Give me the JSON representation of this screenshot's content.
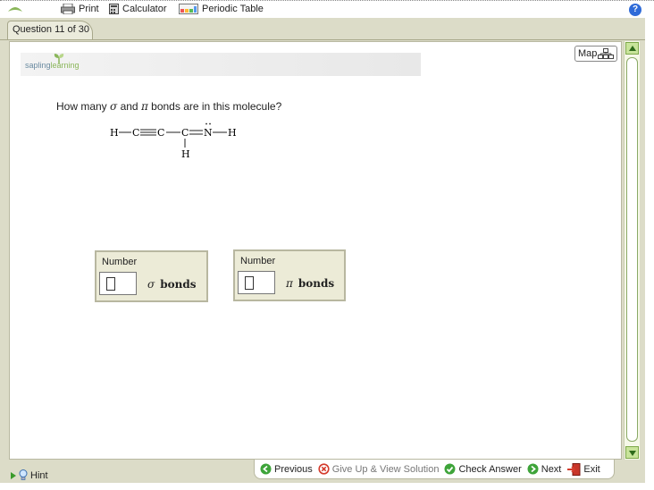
{
  "toolbar": {
    "print": "Print",
    "calculator": "Calculator",
    "periodic_table": "Periodic Table",
    "help": "?"
  },
  "tab": {
    "label": "Question 11 of 30"
  },
  "brand": {
    "part1": "sapling",
    "part2": "learning"
  },
  "map_button": {
    "label": "Map"
  },
  "question": {
    "text_pre": "How many ",
    "sigma": "σ",
    "text_mid": " and ",
    "pi": "π",
    "text_post": " bonds are in this molecule?"
  },
  "molecule": {
    "atoms": [
      "H",
      "C",
      "C",
      "C",
      "N",
      "H",
      "H"
    ]
  },
  "inputs": [
    {
      "label": "Number",
      "value": "",
      "symbol": "σ",
      "unit": "bonds"
    },
    {
      "label": "Number",
      "value": "",
      "symbol": "π",
      "unit": "bonds"
    }
  ],
  "hint": {
    "label": "Hint"
  },
  "nav": {
    "previous": "Previous",
    "give_up": "Give Up & View Solution",
    "check": "Check Answer",
    "next": "Next",
    "exit": "Exit"
  },
  "colors": {
    "frame": "#dcdcc8",
    "accent_green": "#3ea43a",
    "help_blue": "#2f6bd8",
    "exit_red": "#d43b2c"
  }
}
